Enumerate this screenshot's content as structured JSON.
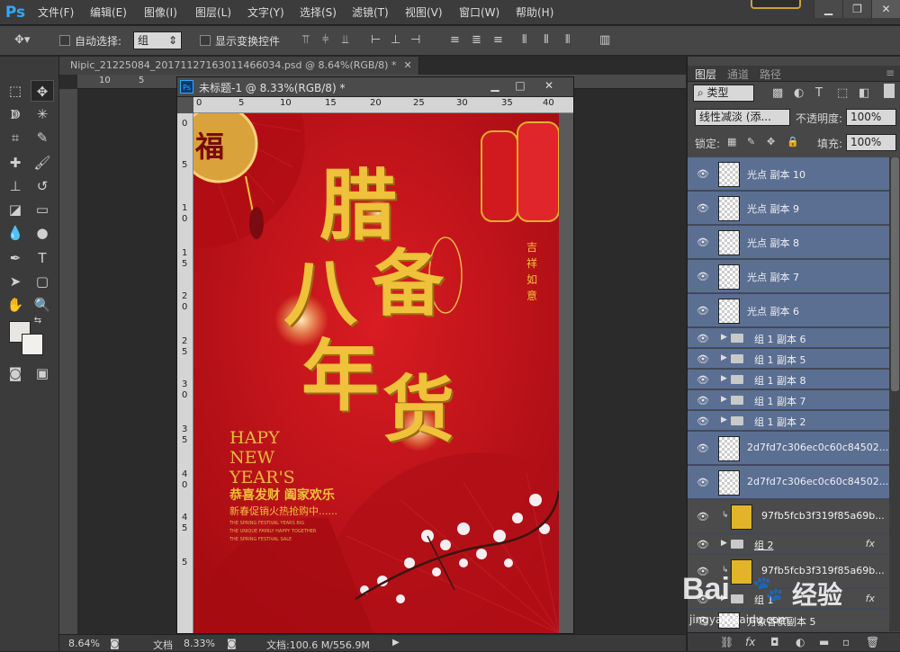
{
  "app": {
    "logo": "Ps"
  },
  "menu": [
    "文件(F)",
    "编辑(E)",
    "图像(I)",
    "图层(L)",
    "文字(Y)",
    "选择(S)",
    "滤镜(T)",
    "视图(V)",
    "窗口(W)",
    "帮助(H)"
  ],
  "window_controls": {
    "minimize": "▁",
    "restore": "❐",
    "close": "✕"
  },
  "options_bar": {
    "auto_select_label": "自动选择:",
    "auto_select_value": "组",
    "show_transform_label": "显示变换控件"
  },
  "main_doc": {
    "tab_title": "Nipic_21225084_20171127163011466034.psd @ 8.64%(RGB/8) *",
    "ruler_h": [
      "10",
      "5"
    ],
    "ruler_v": [
      "0",
      "5",
      "1",
      "0",
      "1",
      "5",
      "2",
      "0",
      "2",
      "5",
      "3",
      "0",
      "3",
      "5",
      "4",
      "0"
    ],
    "zoom": "8.64%",
    "status_label": "文档"
  },
  "doc2": {
    "icon": "Ps",
    "title": "未标题-1 @ 8.33%(RGB/8) *",
    "ruler_h": [
      "0",
      "5",
      "10",
      "15",
      "20",
      "25",
      "30",
      "35",
      "40"
    ],
    "ruler_v": [
      "0",
      "5",
      "1",
      "0",
      "1",
      "5",
      "2",
      "0",
      "2",
      "5",
      "3",
      "0",
      "3",
      "5",
      "4",
      "0",
      "4",
      "5",
      "5"
    ],
    "zoom": "8.33%",
    "status_text": "文档:100.6 M/556.9M"
  },
  "poster": {
    "badge": "福",
    "title_chars": [
      "腊",
      "八",
      "备",
      "年",
      "货"
    ],
    "seal": [
      "吉",
      "祥",
      "如",
      "意"
    ],
    "eng": [
      "HAPY",
      "NEW",
      "YEAR'S"
    ],
    "line1": "恭喜发财 阖家欢乐",
    "line2": "新春促销火热抢购中......",
    "small": [
      "THE SPRING FESTIVAL YEARS BIG",
      "THE UNIQUE FAMILY HAPPY TOGETHER",
      "THE SPRING FESTIVAL SALE"
    ],
    "colors": {
      "bg": "#c4121a",
      "gold": "#f0c13a"
    }
  },
  "panel": {
    "tabs": [
      "图层",
      "通道",
      "路径"
    ],
    "filter_type": "类型",
    "blend_mode": "线性减淡 (添...",
    "opacity_label": "不透明度:",
    "opacity_value": "100%",
    "lock_label": "锁定:",
    "fill_label": "填充:",
    "fill_value": "100%",
    "layers": [
      {
        "name": "光点 副本 10",
        "kind": "pixel"
      },
      {
        "name": "光点 副本 9",
        "kind": "pixel"
      },
      {
        "name": "光点 副本 8",
        "kind": "pixel"
      },
      {
        "name": "光点 副本 7",
        "kind": "pixel"
      },
      {
        "name": "光点 副本 6",
        "kind": "pixel"
      },
      {
        "name": "组 1 副本 6",
        "kind": "group"
      },
      {
        "name": "组 1 副本 5",
        "kind": "group"
      },
      {
        "name": "组 1 副本 8",
        "kind": "group"
      },
      {
        "name": "组 1 副本 7",
        "kind": "group"
      },
      {
        "name": "组 1 副本 2",
        "kind": "group"
      },
      {
        "name": "2d7fd7c306ec0c60c84502...",
        "kind": "pixel"
      },
      {
        "name": "2d7fd7c306ec0c60c84502...",
        "kind": "pixel"
      },
      {
        "name": "97fb5fcb3f319f85a69b...",
        "kind": "gold"
      },
      {
        "name": "组 2",
        "kind": "group-fx"
      },
      {
        "name": "97fb5fcb3f319f85a69b...",
        "kind": "gold"
      },
      {
        "name": "组 1",
        "kind": "group-fx"
      },
      {
        "name": "万象香槟副本 5",
        "kind": "pixel"
      }
    ],
    "fx": "fx"
  },
  "watermark": {
    "brand": "Bai",
    "paw": "🐾",
    "jy": "经验",
    "url": "jingyan.baidu.com"
  }
}
